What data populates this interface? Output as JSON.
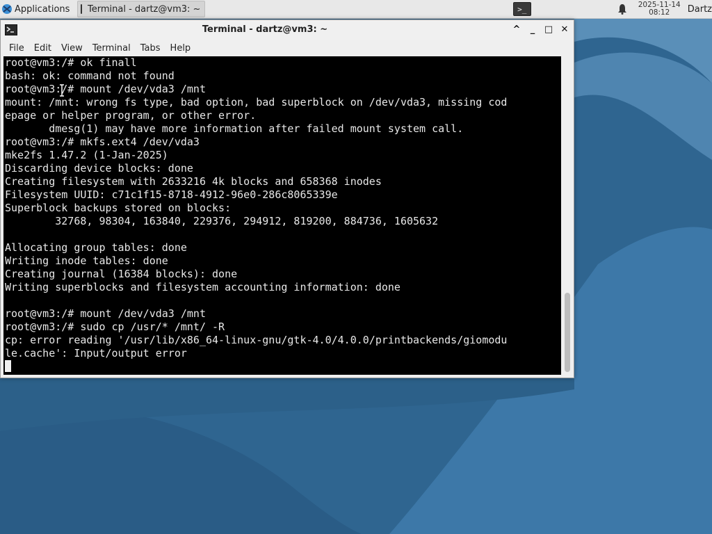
{
  "panel": {
    "applications_label": "Applications",
    "task_label": "Terminal - dartz@vm3: ~",
    "launcher_glyph": ">_",
    "clock_date": "2025-11-14",
    "clock_time": "08:12",
    "user_label": "Dartz"
  },
  "window": {
    "title": "Terminal - dartz@vm3: ~",
    "controls": {
      "shade": "^",
      "minimize": "_",
      "maximize": "□",
      "close": "✕"
    },
    "menu": [
      "File",
      "Edit",
      "View",
      "Terminal",
      "Tabs",
      "Help"
    ]
  },
  "terminal": {
    "lines": [
      "root@vm3:/# ok finall",
      "bash: ok: command not found",
      "root@vm3:/# mount /dev/vda3 /mnt",
      "mount: /mnt: wrong fs type, bad option, bad superblock on /dev/vda3, missing cod",
      "epage or helper program, or other error.",
      "       dmesg(1) may have more information after failed mount system call.",
      "root@vm3:/# mkfs.ext4 /dev/vda3",
      "mke2fs 1.47.2 (1-Jan-2025)",
      "Discarding device blocks: done",
      "Creating filesystem with 2633216 4k blocks and 658368 inodes",
      "Filesystem UUID: c71c1f15-8718-4912-96e0-286c8065339e",
      "Superblock backups stored on blocks:",
      "        32768, 98304, 163840, 229376, 294912, 819200, 884736, 1605632",
      "",
      "Allocating group tables: done",
      "Writing inode tables: done",
      "Creating journal (16384 blocks): done",
      "Writing superblocks and filesystem accounting information: done",
      "",
      "root@vm3:/# mount /dev/vda3 /mnt",
      "root@vm3:/# sudo cp /usr/* /mnt/ -R",
      "cp: error reading '/usr/lib/x86_64-linux-gnu/gtk-4.0/4.0.0/printbackends/giomodu",
      "le.cache': Input/output error"
    ]
  },
  "colors": {
    "terminal_bg": "#000000",
    "terminal_fg": "#e8e8e8",
    "desktop_bg": "#2f6590"
  },
  "icons": {
    "apps": "xfce-mouse-icon",
    "task": "terminal-icon",
    "notification": "bell-icon"
  }
}
